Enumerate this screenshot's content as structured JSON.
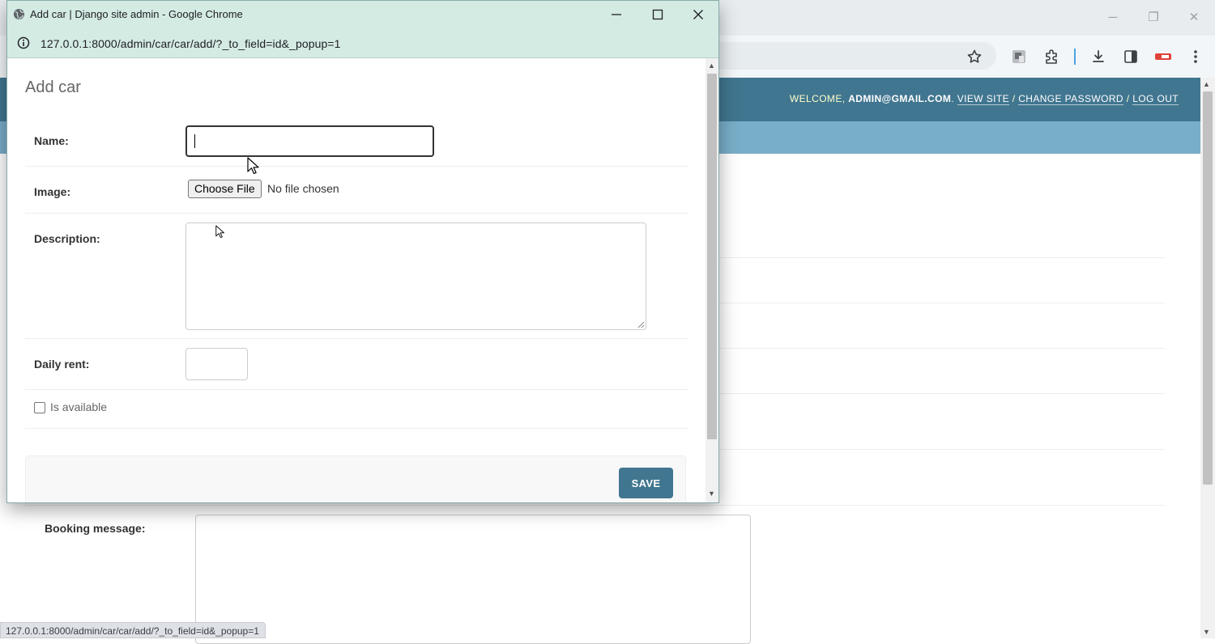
{
  "background_page": {
    "user_tools": {
      "welcome_prefix": "Welcome,",
      "username": "admin@gmail.com",
      "separator": ".",
      "slash": "/",
      "view_site": "View site",
      "change_password": "Change password",
      "log_out": "Log out"
    },
    "booking_message_label": "Booking message:"
  },
  "popup": {
    "window_title": "Add car | Django site admin - Google Chrome",
    "url": "127.0.0.1:8000/admin/car/car/add/?_to_field=id&_popup=1",
    "page_title": "Add car",
    "form": {
      "name_label": "Name:",
      "name_value": "",
      "image_label": "Image:",
      "choose_file_label": "Choose File",
      "file_status": "No file chosen",
      "description_label": "Description:",
      "description_value": "",
      "daily_rent_label": "Daily rent:",
      "daily_rent_value": "",
      "is_available_label": "Is available",
      "is_available_checked": false,
      "save_label": "Save"
    }
  },
  "status_bar_url": "127.0.0.1:8000/admin/car/car/add/?_to_field=id&_popup=1",
  "colors": {
    "django_header": "#417690",
    "django_breadcrumbs": "#79aec8",
    "popup_titlebar": "#d4ebe4",
    "save_button": "#417690"
  }
}
